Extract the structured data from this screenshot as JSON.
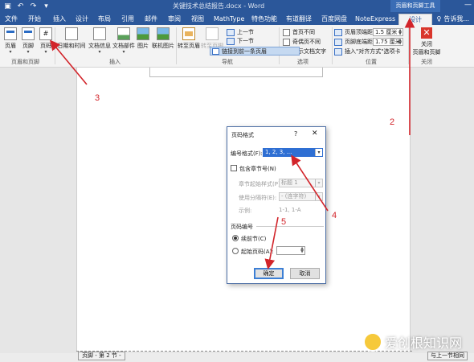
{
  "window": {
    "title": "关键技术总结报告.docx - Word",
    "context_tools": "页眉和页脚工具"
  },
  "tabs": [
    {
      "label": "文件"
    },
    {
      "label": "开始"
    },
    {
      "label": "插入"
    },
    {
      "label": "设计"
    },
    {
      "label": "布局"
    },
    {
      "label": "引用"
    },
    {
      "label": "邮件"
    },
    {
      "label": "审阅"
    },
    {
      "label": "视图"
    },
    {
      "label": "MathType"
    },
    {
      "label": "特色功能"
    },
    {
      "label": "有道翻译"
    },
    {
      "label": "百度网盘"
    },
    {
      "label": "NoteExpress"
    },
    {
      "label": "设计",
      "active": true
    }
  ],
  "tell_me": "告诉我...",
  "ribbon": {
    "groups": {
      "header_footer": "页眉和页脚",
      "insert": "插入",
      "navigation": "导航",
      "options": "选项",
      "position": "位置",
      "close": "关闭"
    },
    "buttons": {
      "header": "页眉",
      "footer": "页脚",
      "page_number": "页码",
      "datetime": "日期和时间",
      "docinfo": "文档信息",
      "docparts": "文档部件",
      "picture": "图片",
      "online_picture": "联机图片",
      "goto_header": "转至页眉",
      "goto_footer": "转至页脚",
      "prev_section": "上一节",
      "next_section": "下一节",
      "link_prev": "链接到前一条页眉",
      "first_page_diff": "首页不同",
      "odd_even_diff": "奇偶页不同",
      "show_doc_text": "显示文档文字",
      "header_top_dist": "页眉顶端距离:",
      "footer_bottom_dist": "页脚底端距离:",
      "header_top_value": "1.5 厘米",
      "footer_bottom_value": "1.75 厘米",
      "insert_align_tab": "插入\"对齐方式\"选项卡",
      "close_line1": "关闭",
      "close_line2": "页眉和页脚"
    }
  },
  "dialog": {
    "title": "页码格式",
    "help": "?",
    "close": "✕",
    "number_format_label": "编号格式(F):",
    "number_format_value": "1, 2, 3, ...",
    "include_chapter": "包含章节号(N)",
    "chapter_style_label": "章节起始样式(P)",
    "chapter_style_value": "标题 1",
    "separator_label": "使用分隔符(E):",
    "separator_value": "-  (连字符)",
    "example_label": "示例:",
    "example_value": "1-1, 1-A",
    "page_numbering_title": "页码编号",
    "continue_label": "续前节(C)",
    "start_at_label": "起始页码(A):",
    "ok": "确定",
    "cancel": "取消"
  },
  "footer_tags": {
    "left": "页脚 - 第 2 节 -",
    "right": "与上一节相同"
  },
  "annotations": [
    "2",
    "3",
    "4",
    "5"
  ],
  "watermark": "爱创根知识网",
  "colors": {
    "word_blue": "#2b579a",
    "selection": "#2f6fd3",
    "annotation_red": "#d2242a"
  }
}
